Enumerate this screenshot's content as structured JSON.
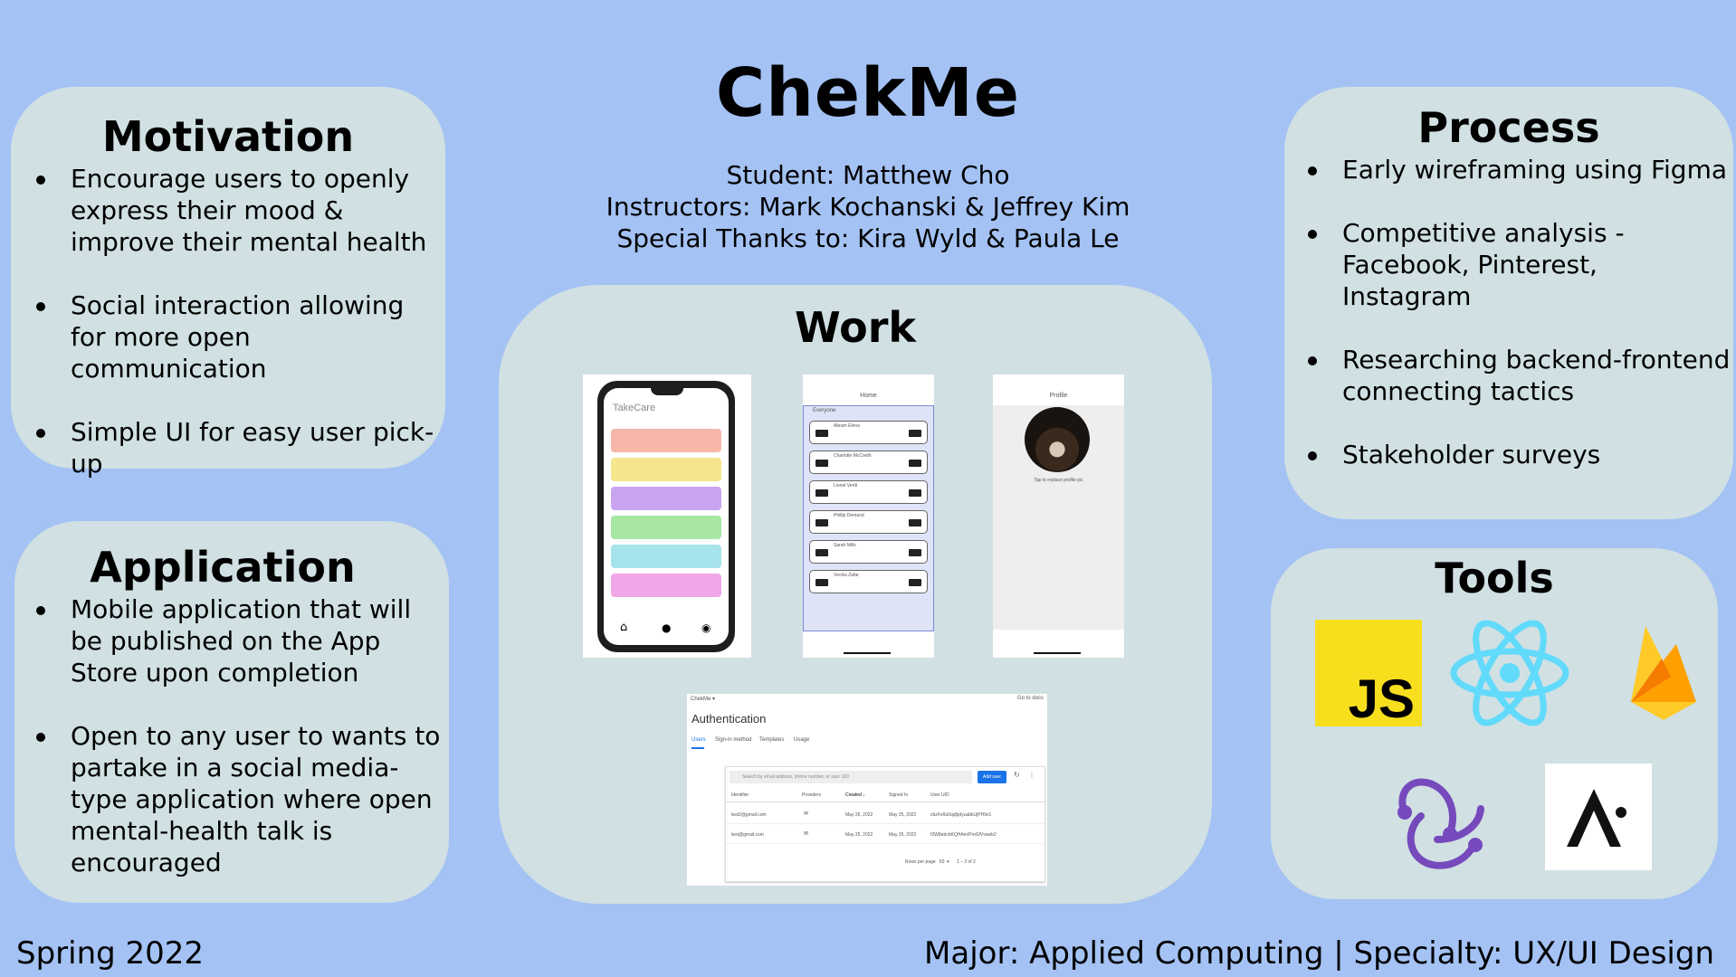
{
  "title": "ChekMe",
  "credits": {
    "student": "Student: Matthew Cho",
    "instructors": "Instructors: Mark Kochanski & Jeffrey Kim",
    "thanks": "Special Thanks to: Kira Wyld & Paula Le"
  },
  "motivation": {
    "heading": "Motivation",
    "items": [
      "Encourage users to openly express their mood & improve their mental health",
      "Social interaction allowing for more open communication",
      "Simple UI for easy user pick-up"
    ]
  },
  "application": {
    "heading": "Application",
    "items": [
      "Mobile application that will be published on the App Store upon completion",
      "Open to any user to wants to partake in a social media-type application where open mental-health talk is encouraged"
    ]
  },
  "work": {
    "heading": "Work",
    "phone1": {
      "app_name": "TakeCare"
    },
    "phone2": {
      "header": "Home",
      "filter": "Everyone",
      "names": [
        "Abram Elena",
        "Charlotte McCreith",
        "Lionel Verdi",
        "Phillip Demand",
        "Sarah Mills",
        "Vecika Zafar"
      ]
    },
    "phone3": {
      "header": "Profile",
      "caption": "Tap to replace profile pic"
    },
    "auth": {
      "brand": "ChekMe ▾",
      "docs_link": "Go to docs",
      "heading": "Authentication",
      "tabs": [
        "Users",
        "Sign-in method",
        "Templates",
        "Usage"
      ],
      "search_placeholder": "Search by email address, phone number, or user UID",
      "add_user": "Add user",
      "columns": [
        "Identifier",
        "Providers",
        "Created ↓",
        "Signed In",
        "User UID"
      ],
      "rows": [
        [
          "test2@gmail.com",
          "✉",
          "May 25, 2022",
          "May 25, 2022",
          "cbzFe0u0qq5jdyuabkUjPH9v1"
        ],
        [
          "test@gmail.com",
          "✉",
          "May 25, 2022",
          "May 25, 2022",
          "f2W8ebcbKQHAm/PmGfVvweb2"
        ]
      ],
      "pagination": "Rows per page   50  ▾      1 – 2 of 2"
    }
  },
  "process": {
    "heading": "Process",
    "items": [
      "Early wireframing using Figma",
      "Competitive analysis - Facebook, Pinterest, Instagram",
      "Researching backend-frontend connecting tactics",
      "Stakeholder surveys"
    ]
  },
  "tools": {
    "heading": "Tools",
    "js_label": "JS",
    "icons": [
      "javascript-icon",
      "react-icon",
      "firebase-icon",
      "redux-icon",
      "expo-icon"
    ]
  },
  "footer": {
    "left": "Spring 2022",
    "right": "Major: Applied Computing | Specialty: UX/UI Design"
  },
  "colors": {
    "background": "#a4c2f4",
    "panel": "#d0e0e3",
    "js_yellow": "#f7df1e",
    "react_blue": "#61dafb",
    "redux_purple": "#764abc",
    "firebase_orange": "#ffa000"
  }
}
